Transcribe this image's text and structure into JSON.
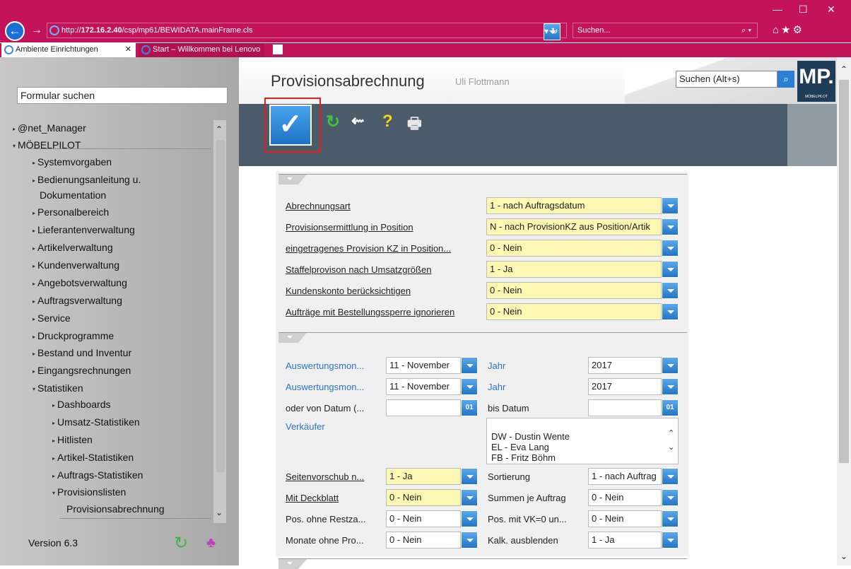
{
  "browser": {
    "address_prefix": "http://",
    "address_host": "172.16.2.40",
    "address_path": "/csp/mp61/BEWIDATA.mainFrame.cls",
    "address_dropdown": "▾ ↻",
    "search_placeholder": "Suchen...",
    "search_icon": "⌕ ▾",
    "window_min": "—",
    "window_max": "☐",
    "window_close": "✕",
    "toolbar_icons": "⌂★⚙",
    "tabs": [
      {
        "label": "Ambiente Einrichtungen",
        "close": "✕"
      },
      {
        "label": "Start – Willkommen bei Lenovo"
      }
    ]
  },
  "sidebar": {
    "form_search_placeholder": "Formular suchen",
    "items": [
      {
        "label": "@net_Manager",
        "arrow": "▸"
      },
      {
        "label": "MÖBELPILOT",
        "arrow": "▾"
      },
      {
        "label": "Systemvorgaben",
        "arrow": "▸"
      },
      {
        "label": "Bedienungsanleitung u.",
        "arrow": "▸"
      },
      {
        "label": "Dokumentation"
      },
      {
        "label": "Personalbereich",
        "arrow": "▸"
      },
      {
        "label": "Lieferantenverwaltung",
        "arrow": "▸"
      },
      {
        "label": "Artikelverwaltung",
        "arrow": "▸"
      },
      {
        "label": "Kundenverwaltung",
        "arrow": "▸"
      },
      {
        "label": "Angebotsverwaltung",
        "arrow": "▸"
      },
      {
        "label": "Auftragsverwaltung",
        "arrow": "▸"
      },
      {
        "label": "Service",
        "arrow": "▸"
      },
      {
        "label": "Druckprogramme",
        "arrow": "▸"
      },
      {
        "label": "Bestand und Inventur",
        "arrow": "▸"
      },
      {
        "label": "Eingangsrechnungen",
        "arrow": "▸"
      },
      {
        "label": "Statistiken",
        "arrow": "▾"
      },
      {
        "label": "Dashboards",
        "arrow": "▸"
      },
      {
        "label": "Umsatz-Statistiken",
        "arrow": "▸"
      },
      {
        "label": "Hitlisten",
        "arrow": "▸"
      },
      {
        "label": "Artikel-Statistiken",
        "arrow": "▸"
      },
      {
        "label": "Auftrags-Statistiken",
        "arrow": "▸"
      },
      {
        "label": "Provisionslisten",
        "arrow": "▾"
      },
      {
        "label": "Provisionsabrechnung"
      }
    ],
    "version": "Version 6.3"
  },
  "header": {
    "title": "Provisionsabrechnung",
    "user": "Uli Flottmann",
    "quick_search_placeholder": "Suchen (Alt+s)",
    "logo_text": "MP.",
    "logo_sub": "MÖBELPILOT"
  },
  "toolbar": {
    "ok_icon": "✓",
    "refresh_icon": "↻",
    "back_icon": "⇜",
    "help_icon": "?",
    "print_icon": "🖶"
  },
  "panel1": {
    "rows": [
      {
        "label": "Abrechnungsart",
        "value": "1 - nach Auftragsdatum"
      },
      {
        "label": "Provisionsermittlung in Position",
        "value": "N - nach ProvisionKZ aus Position/Artik"
      },
      {
        "label": "eingetragenes Provision KZ in Position...",
        "value": "0 - Nein"
      },
      {
        "label": "Staffelprovison nach Umsatzgrößen",
        "value": "1 - Ja"
      },
      {
        "label": "Kundenskonto berücksichtigen",
        "value": "0 - Nein"
      },
      {
        "label": "Aufträge mit Bestellungssperre ignorieren",
        "value": "0 - Nein"
      }
    ]
  },
  "panel2": {
    "auswertung1_label": "Auswertungsmon...",
    "auswertung1_value": "11 - November",
    "jahr1_label": "Jahr",
    "jahr1_value": "2017",
    "auswertung2_label": "Auswertungsmon...",
    "auswertung2_value": "11 - November",
    "jahr2_label": "Jahr",
    "jahr2_value": "2017",
    "von_datum_label": "oder von Datum (...",
    "bis_datum_label": "bis Datum",
    "calendar_text": "01",
    "verkaeufer_label": "Verkäufer",
    "verkaeufer_list": [
      "DW - Dustin Wente",
      "EL - Eva Lang",
      "FB - Fritz Böhm"
    ],
    "list_up": "⌃",
    "list_down": "⌄",
    "seitenvorschub_label": "Seitenvorschub n...",
    "seitenvorschub_value": "1 - Ja",
    "sortierung_label": "Sortierung",
    "sortierung_value": "1 - nach Auftrag",
    "deckblatt_label": "Mit Deckblatt",
    "deckblatt_value": "0 - Nein",
    "summen_label": "Summen je Auftrag",
    "summen_value": "0 - Nein",
    "pos_ohne_label": "Pos. ohne Restza...",
    "pos_ohne_value": "0 - Nein",
    "pos_vk_label": "Pos. mit VK=0 un...",
    "pos_vk_value": "0 - Nein",
    "monate_label": "Monate ohne Pro...",
    "monate_value": "0 - Nein",
    "kalk_label": "Kalk. ausblenden",
    "kalk_value": "1 - Ja"
  }
}
